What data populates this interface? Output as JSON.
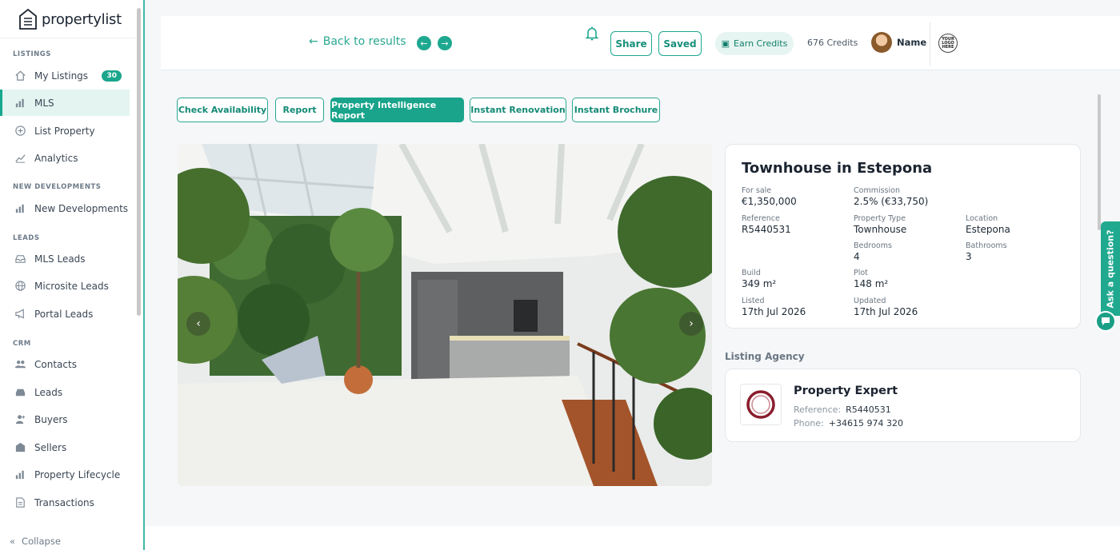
{
  "app": {
    "logo_text": "propertylist"
  },
  "sidebar": {
    "sections": {
      "listings": "LISTINGS",
      "new_developments": "NEW DEVELOPMENTS",
      "leads": "LEADS",
      "crm": "CRM"
    },
    "items": [
      {
        "label": "My Listings",
        "icon": "home-icon",
        "badge": "30"
      },
      {
        "label": "MLS",
        "icon": "bar-chart-icon",
        "active": true
      },
      {
        "label": "List Property",
        "icon": "plus-circle-icon"
      },
      {
        "label": "Analytics",
        "icon": "line-chart-icon"
      },
      {
        "label": "New Developments",
        "icon": "bar-chart-icon"
      },
      {
        "label": "MLS Leads",
        "icon": "inbox-icon"
      },
      {
        "label": "Microsite Leads",
        "icon": "globe-icon"
      },
      {
        "label": "Portal Leads",
        "icon": "megaphone-icon"
      },
      {
        "label": "Contacts",
        "icon": "users-icon"
      },
      {
        "label": "Leads",
        "icon": "inbox-icon"
      },
      {
        "label": "Buyers",
        "icon": "user-icon"
      },
      {
        "label": "Sellers",
        "icon": "building-icon"
      },
      {
        "label": "Property Lifecycle",
        "icon": "bar-chart-icon"
      },
      {
        "label": "Transactions",
        "icon": "document-icon"
      }
    ],
    "collapse_label": "Collapse"
  },
  "topbar": {
    "back_label": "Back to results",
    "share_label": "Share",
    "saved_label": "Saved",
    "earn_label": "Earn Credits",
    "credits": "676 Credits",
    "user_name": "Name",
    "logo_badge": "YOUR LOGO HERE"
  },
  "actions": [
    {
      "label": "Check Availability"
    },
    {
      "label": "Report"
    },
    {
      "label": "Property Intelligence Report",
      "primary": true
    },
    {
      "label": "Instant Renovation"
    },
    {
      "label": "Instant Brochure"
    }
  ],
  "property": {
    "title": "Townhouse in Estepona",
    "for_sale_label": "For sale",
    "price": "€1,350,000",
    "commission_label": "Commission",
    "commission": "2.5% (€33,750)",
    "reference_label": "Reference",
    "reference": "R5440531",
    "type_label": "Property Type",
    "type": "Townhouse",
    "location_label": "Location",
    "location": "Estepona",
    "bedrooms_label": "Bedrooms",
    "bedrooms": "4",
    "bathrooms_label": "Bathrooms",
    "bathrooms": "3",
    "build_label": "Build",
    "build": "349 m²",
    "plot_label": "Plot",
    "plot": "148 m²",
    "listed_label": "Listed",
    "listed": "17th Jul 2026",
    "updated_label": "Updated",
    "updated": "17th Jul 2026"
  },
  "agency": {
    "section_label": "Listing Agency",
    "name": "Property Expert",
    "reference_label": "Reference:",
    "reference": "R5440531",
    "phone_label": "Phone:",
    "phone": "+34615 974 320"
  },
  "help": {
    "ask_label": "Ask a question?"
  },
  "colors": {
    "accent": "#19a48b",
    "sidebar_active_bg": "#e3f4f1"
  }
}
